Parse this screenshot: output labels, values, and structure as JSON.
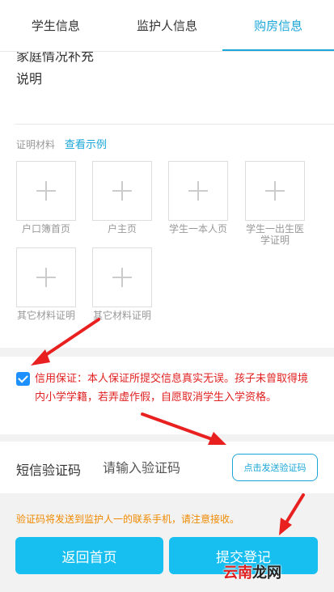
{
  "tabs": [
    {
      "label": "学生信息"
    },
    {
      "label": "监护人信息"
    },
    {
      "label": "购房信息",
      "active": true
    }
  ],
  "family_situation_title_cut": "家庭情况补充",
  "explain_label": "说明",
  "materials": {
    "title": "证明材料",
    "example_link": "查看示例",
    "slots": [
      {
        "label": "户口簿首页"
      },
      {
        "label": "户主页"
      },
      {
        "label": "学生一本人页"
      },
      {
        "label": "学生一出生医学证明"
      },
      {
        "label": "其它材料证明"
      },
      {
        "label": "其它材料证明"
      }
    ]
  },
  "guarantee": {
    "checked": true,
    "text": "信用保证：本人保证所提交信息真实无误。孩子未曾取得境内小学学籍，若弄虚作假，自愿取消学生入学资格。"
  },
  "sms": {
    "label": "短信验证码",
    "placeholder": "请输入验证码",
    "value": "",
    "send_button": "点击发送验证码"
  },
  "notice": "验证码将发送到监护人一的联系手机，请注意接收。",
  "buttons": {
    "back": "返回首页",
    "submit": "提交登记"
  },
  "watermark": {
    "part1": "云南",
    "part2": "龙网"
  },
  "colors": {
    "accent": "#1aa6d8",
    "button": "#17bff0",
    "warning_text": "#e02020",
    "notice_text": "#f08a00",
    "checkbox": "#1e90ff"
  }
}
